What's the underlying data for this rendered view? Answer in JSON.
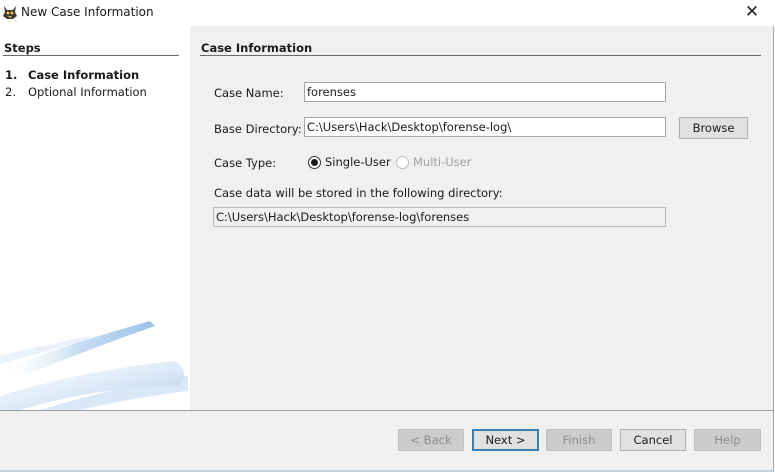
{
  "window": {
    "title": "New Case Information",
    "close_glyph": "✕",
    "app_icon": "autopsy-dog-icon"
  },
  "steps": {
    "header": "Steps",
    "items": [
      {
        "num": "1.",
        "label": "Case Information",
        "active": true
      },
      {
        "num": "2.",
        "label": "Optional Information",
        "active": false
      }
    ]
  },
  "content": {
    "header": "Case Information",
    "case_name_label": "Case Name:",
    "case_name_value": "forenses",
    "base_dir_label": "Base Directory:",
    "base_dir_value": "C:\\Users\\Hack\\Desktop\\forense-log\\",
    "browse_label": "Browse",
    "case_type_label": "Case Type:",
    "case_type_options": [
      {
        "label": "Single-User",
        "selected": true,
        "enabled": true
      },
      {
        "label": "Multi-User",
        "selected": false,
        "enabled": false
      }
    ],
    "storage_note": "Case data will be stored in the following directory:",
    "storage_path": "C:\\Users\\Hack\\Desktop\\forense-log\\forenses"
  },
  "buttons": {
    "back": "< Back",
    "next": "Next >",
    "finish": "Finish",
    "cancel": "Cancel",
    "help": "Help"
  },
  "colors": {
    "panel_bg": "#f0f0f0",
    "default_button_border": "#3c7fb1",
    "swoosh_blue": "#9fc3e8"
  }
}
